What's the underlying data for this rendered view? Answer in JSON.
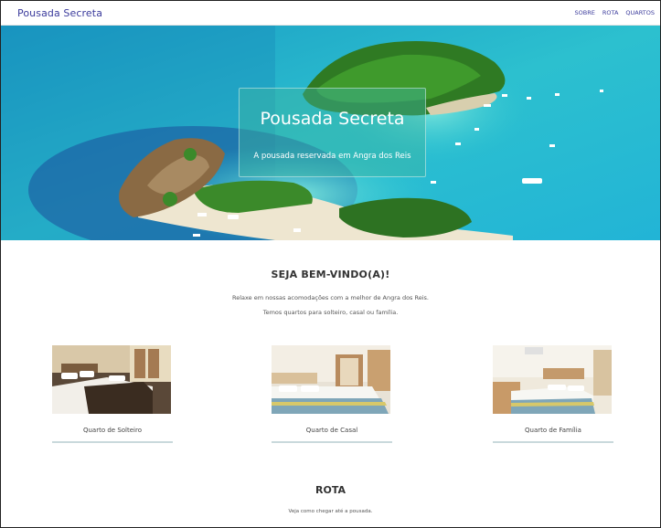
{
  "navbar": {
    "brand": "Pousada Secreta",
    "links": [
      "SOBRE",
      "ROTA",
      "QUARTOS"
    ]
  },
  "hero": {
    "title": "Pousada Secreta",
    "subtitle": "A pousada reservada em Angra dos Reis"
  },
  "welcome": {
    "title": "SEJA BEM-VINDO(A)!",
    "line1": "Relaxe em nossas acomodações com a melhor de Angra dos Reis.",
    "line2": "Temos quartos para solteiro, casal ou família."
  },
  "rooms": [
    {
      "label": "Quarto de Solteiro"
    },
    {
      "label": "Quarto de Casal"
    },
    {
      "label": "Quarto de Família"
    }
  ],
  "rota": {
    "title": "ROTA",
    "subtitle": "Veja como chegar até a pousada."
  }
}
